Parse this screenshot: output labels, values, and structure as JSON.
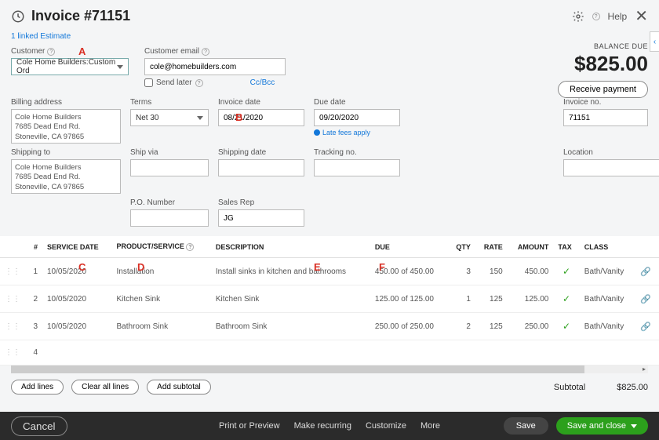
{
  "header": {
    "title": "Invoice #71151",
    "help": "Help"
  },
  "linked_estimate": "1 linked Estimate",
  "customer": {
    "label": "Customer",
    "value": "Cole Home Builders:Custom Ord"
  },
  "customer_email": {
    "label": "Customer email",
    "value": "cole@homebuilders.com"
  },
  "send_later": "Send later",
  "ccbcc": "Cc/Bcc",
  "balance": {
    "label": "BALANCE DUE",
    "amount": "$825.00",
    "receive": "Receive payment"
  },
  "fields": {
    "billing_address": {
      "label": "Billing address",
      "value": "Cole Home Builders\n7685 Dead End Rd.\nStoneville, CA 97865"
    },
    "terms": {
      "label": "Terms",
      "value": "Net 30"
    },
    "invoice_date": {
      "label": "Invoice date",
      "value": "08/21/2020"
    },
    "due_date": {
      "label": "Due date",
      "value": "09/20/2020"
    },
    "invoice_no": {
      "label": "Invoice no.",
      "value": "71151"
    },
    "shipping_to": {
      "label": "Shipping to",
      "value": "Cole Home Builders\n7685 Dead End Rd.\nStoneville, CA 97865"
    },
    "ship_via": {
      "label": "Ship via",
      "value": ""
    },
    "shipping_date": {
      "label": "Shipping date",
      "value": ""
    },
    "tracking_no": {
      "label": "Tracking no.",
      "value": ""
    },
    "location": {
      "label": "Location",
      "value": ""
    },
    "po_number": {
      "label": "P.O. Number",
      "value": ""
    },
    "sales_rep": {
      "label": "Sales Rep",
      "value": "JG"
    },
    "late_fees": "Late fees apply"
  },
  "columns": {
    "num": "#",
    "service_date": "SERVICE DATE",
    "product": "PRODUCT/SERVICE",
    "description": "DESCRIPTION",
    "due": "DUE",
    "qty": "QTY",
    "rate": "RATE",
    "amount": "AMOUNT",
    "tax": "TAX",
    "class": "CLASS"
  },
  "rows": [
    {
      "n": "1",
      "date": "10/05/2020",
      "product": "Installation",
      "desc": "Install sinks in kitchen and bathrooms",
      "due": "450.00 of 450.00",
      "qty": "3",
      "rate": "150",
      "amount": "450.00",
      "class": "Bath/Vanity"
    },
    {
      "n": "2",
      "date": "10/05/2020",
      "product": "Kitchen Sink",
      "desc": "Kitchen Sink",
      "due": "125.00 of 125.00",
      "qty": "1",
      "rate": "125",
      "amount": "125.00",
      "class": "Bath/Vanity"
    },
    {
      "n": "3",
      "date": "10/05/2020",
      "product": "Bathroom Sink",
      "desc": "Bathroom Sink",
      "due": "250.00 of 250.00",
      "qty": "2",
      "rate": "125",
      "amount": "250.00",
      "class": "Bath/Vanity"
    },
    {
      "n": "4",
      "date": "",
      "product": "",
      "desc": "",
      "due": "",
      "qty": "",
      "rate": "",
      "amount": "",
      "class": ""
    }
  ],
  "buttons": {
    "add_lines": "Add lines",
    "clear_all": "Clear all lines",
    "add_subtotal": "Add subtotal"
  },
  "subtotal": {
    "label": "Subtotal",
    "value": "$825.00"
  },
  "footer": {
    "cancel": "Cancel",
    "print": "Print or Preview",
    "recurring": "Make recurring",
    "customize": "Customize",
    "more": "More",
    "save": "Save",
    "save_close": "Save and close"
  },
  "annotations": {
    "A": "A",
    "B": "B",
    "C": "C",
    "D": "D",
    "E": "E",
    "F": "F"
  }
}
